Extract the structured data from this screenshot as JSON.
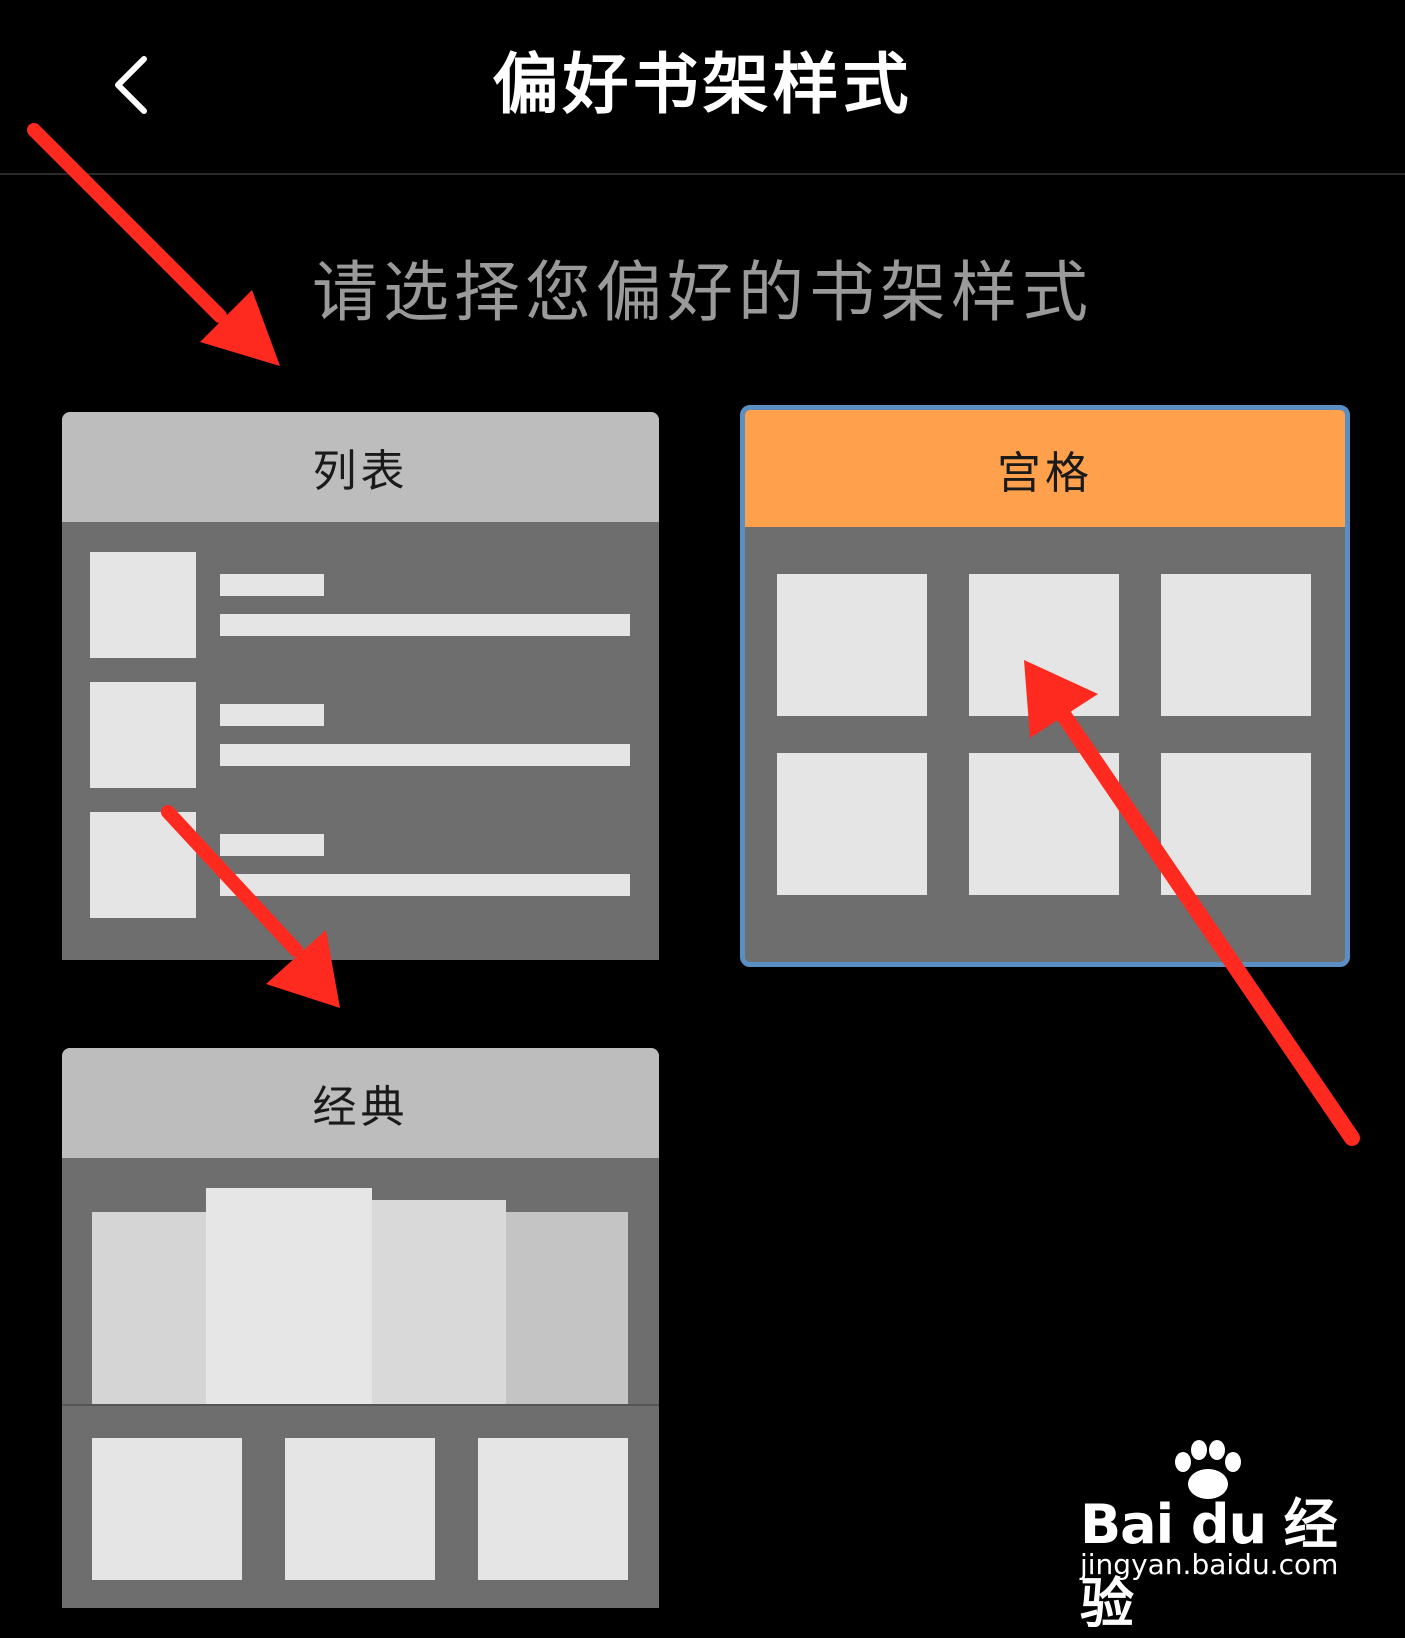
{
  "header": {
    "title": "偏好书架样式",
    "back_icon": "chevron-left-icon"
  },
  "subtitle": "请选择您偏好的书架样式",
  "styles": [
    {
      "label": "列表",
      "selected": false
    },
    {
      "label": "宫格",
      "selected": true
    },
    {
      "label": "经典",
      "selected": false
    }
  ],
  "colors": {
    "background": "#000000",
    "selected_header": "#ffa04c",
    "selected_border": "#5b8ec2",
    "unselected_header": "#bdbdbd",
    "card_body": "#6e6e6e",
    "placeholder_block": "#e5e5e5",
    "annotation_arrow": "#ff2a1f"
  },
  "watermark": {
    "brand": "Bai du 经验",
    "url": "jingyan.baidu.com"
  }
}
